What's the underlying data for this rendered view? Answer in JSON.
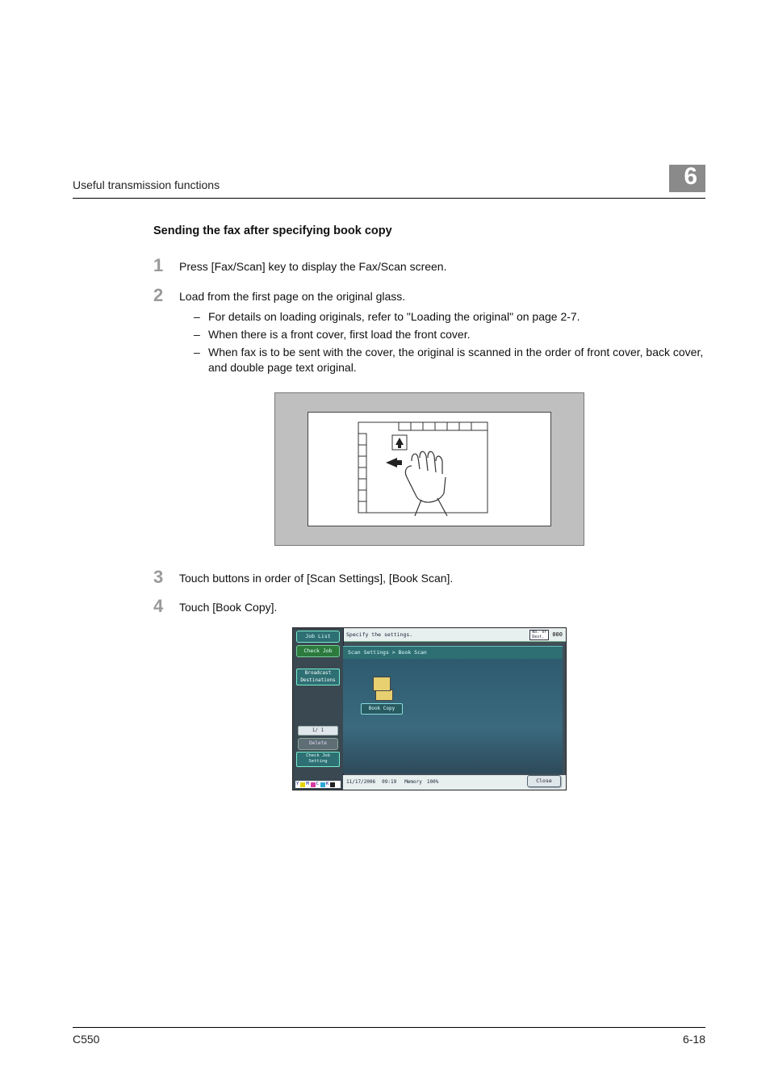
{
  "header": {
    "running_head": "Useful transmission functions",
    "chapter_number": "6"
  },
  "section": {
    "title": "Sending the fax after specifying book copy"
  },
  "steps": [
    {
      "num": "1",
      "text": "Press [Fax/Scan] key to display the Fax/Scan screen.",
      "subs": []
    },
    {
      "num": "2",
      "text": "Load from the first page on the original glass.",
      "subs": [
        "For details on loading originals, refer to \"Loading the original\" on page 2-7.",
        "When there is a front cover, first load the front cover.",
        "When fax is to be sent with the cover, the original is scanned in the order of front cover, back cover, and double page text original."
      ]
    },
    {
      "num": "3",
      "text": "Touch buttons in order of [Scan Settings], [Book Scan].",
      "subs": []
    },
    {
      "num": "4",
      "text": "Touch [Book Copy].",
      "subs": []
    }
  ],
  "screenshot": {
    "top_instruction": "Specify the settings.",
    "dest_label": "No. of\nDest.",
    "dest_count": "000",
    "left_buttons": {
      "job_list": "Job List",
      "check_job": "Check Job",
      "broadcast": "Broadcast\nDestinations",
      "pager": "1/  1",
      "delete": "Delete",
      "check_setting": "Check Job\nSetting"
    },
    "toner": {
      "letters": [
        "Y",
        "M",
        "C",
        "K"
      ]
    },
    "breadcrumb": "Scan Settings > Book Scan",
    "main_button": "Book Copy",
    "bottom": {
      "date": "11/17/2006",
      "time": "09:19",
      "memory_label": "Memory",
      "memory_value": "100%"
    },
    "close": "Close"
  },
  "footer": {
    "model": "C550",
    "page": "6-18"
  }
}
